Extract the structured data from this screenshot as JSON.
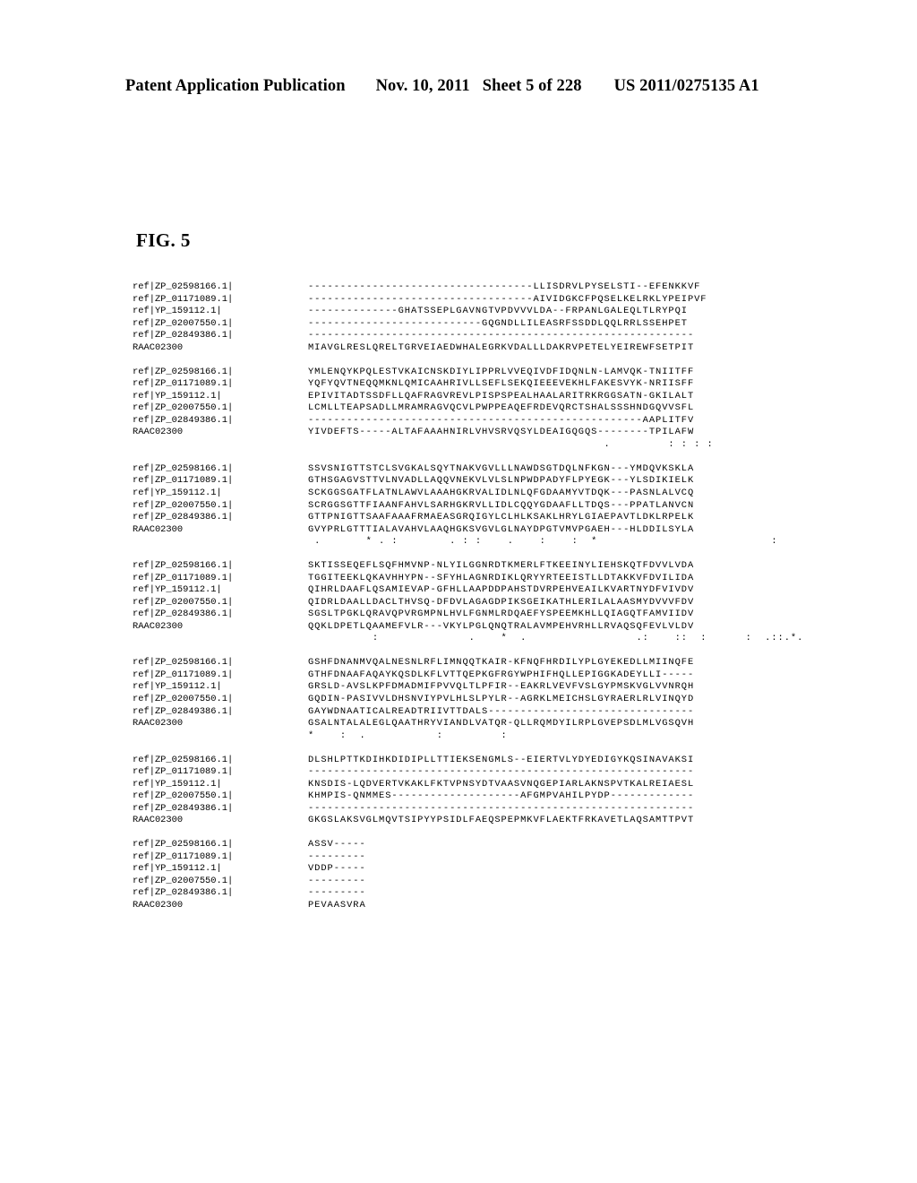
{
  "header": {
    "publication": "Patent Application Publication",
    "date": "Nov. 10, 2011",
    "sheet": "Sheet 5 of 228",
    "number": "US 2011/0275135 A1"
  },
  "figure": {
    "title": "FIG. 5"
  },
  "alignment": {
    "labels": [
      "ref|ZP_02598166.1|",
      "ref|ZP_01171089.1|",
      "ref|YP_159112.1|",
      "ref|ZP_02007550.1|",
      "ref|ZP_02849386.1|",
      "RAAC02300"
    ],
    "blocks": [
      {
        "sequences": [
          "-----------------------------------LLISDRVLPYSELSTI--EFENKKVF",
          "-----------------------------------AIVIDGKCFPQSELKELRKLYPEIPVF",
          "--------------GHATSSEPLGAVNGTVPDVVVLDA--FRPANLGALEQLTLRYPQI",
          "---------------------------GQGNDLLILEASRFSSDDLQQLRRLSSEHPET",
          "------------------------------------------------------------",
          "MIAVGLRESLQRELTGRVEIAEDWHALEGRKVDALLLDAKRVPETELYEIREWFSETPIT"
        ],
        "consensus": ""
      },
      {
        "sequences": [
          "YMLENQYKPQLESTVKAICNSKDIYLIPPRLVVEQIVDFIDQNLN-LAMVQK-TNIITFF",
          "YQFYQVTNEQQMKNLQMICAAHRIVLLSEFLSEKQIEEEVEKHLFAKESVYK-NRIISFF",
          "EPIVITADTSSDFLLQAFRAGVREVLPISPSPEALHAALARITRKRGGSATN-GKILALT",
          "LCMLLTEAPSADLLMRAMRAGVQCVLPWPPEAQEFRDEVQRCTSHALSSSHNDGQVVSFL",
          "----------------------------------------------------AAPLITFV",
          "YIVDEFTS-----ALTAFAAAHNIRLVHVSRVQSYLDEAIGQGQS--------TPILAFW"
        ],
        "consensus": "                                              .         : : : :"
      },
      {
        "sequences": [
          "SSVSNIGTTSTCLSVGKALSQYTNAKVGVLLLNAWDSGTDQLNFKGN---YMDQVKSKLA",
          "GTHSGAGVSTTVLNVADLLAQQVNEKVLVLSLNPWDPADYFLPYEGK---YLSDIKIELK",
          "SCKGGSGATFLATNLAWVLAAAHGKRVALIDLNLQFGDAAMYVTDQK---PASNLALVCQ",
          "SCRGGSGTTFIAANFAHVLSARHGKRVLLIDLCQQYGDAAFLLTDQS---PPATLANVCN",
          "GTTPNIGTTSAAFAAAFRMAEASGRQIGYLCLHLKSAKLHRYLGIAEPAVTLDKLRPELK",
          "GVYPRLGTTTIALAVAHVLAAQHGKSVGVLGLNAYDPGTVMVPGAEH---HLDDILSYLA"
        ],
        "consensus": " .       * . :        . : :    .    :    :  *                           :"
      },
      {
        "sequences": [
          "SKTISSEQEFLSQFHMVNP-NLYILGGNRDTKMERLFTKEEINYLIEHSKQTFDVVLVDA",
          "TGGITEEKLQKAVHHYPN--SFYHLAGNRDIKLQRYYRTEEISTLLDTAKKVFDVILIDA",
          "QIHRLDAAFLQSAMIEVAP-GFHLLAAPDDPAHSTDVRPEHVEAILKVARTNYDFVIVDV",
          "QIDRLDAALLDACLTHVSQ-DFDVLAGAGDPIKSGEIKATHLERILALAASMYDVVVFDV",
          "SGSLTPGKLQRAVQPVRGMPNLHVLFGNMLRDQAEFYSPEEMKHLLQIAGQTFAMVIIDV",
          "QQKLDPETLQAAMEFVLR---VKYLPGLQNQTRALAVMPEHVRHLLRVAQSQFEVLVLDV"
        ],
        "consensus": "          :              .    *  .                 .:    ::  :      :  .::.*."
      },
      {
        "sequences": [
          "GSHFDNANMVQALNESNLRFLIMNQQTKAIR-KFNQFHRDILYPLGYEKEDLLMIINQFE",
          "GTHFDNAAFAQAYKQSDLKFLVTTQEPKGFRGYWPHIFHQLLEPIGGKADEYLLI-----",
          "GRSLD-AVSLKPFDMADMIFPVVQLTLPFIR--EAKRLVEVFVSLGYPMSKVGLVVNRQH",
          "GQDIN-PASIVVLDHSNVIYPVLHLSLPYLR--AGRKLMEICHSLGYRAERLRLVINQYD",
          "GAYWDNAATICALREADTRIIVTTDALS--------------------------------",
          "GSALNTALALEGLQAATHRYVIANDLVATQR-QLLRQMDYILRPLGVEPSDLMLVGSQVH"
        ],
        "consensus": "*    :  .           :         :"
      },
      {
        "sequences": [
          "DLSHLPTTKDIHKDIDIPLLTTIEKSENGMLS--EIERTVLYDYEDIGYKQSINAVAKSI",
          "------------------------------------------------------------",
          "KNSDIS-LQDVERTVKAKLFKTVPNSYDTVAASVNQGEPIARLAKNSPVTKALREIAESL",
          "KHMPIS-QNMMES--------------------AFGMPVAHILPYDP-------------",
          "------------------------------------------------------------",
          "GKGSLAKSVGLMQVTSIPYYPSIDLFAEQSPEPMKVFLAEKTFRKAVETLAQSAMTTPVT"
        ],
        "consensus": ""
      },
      {
        "sequences": [
          "ASSV-----",
          "---------",
          "VDDP-----",
          "---------",
          "---------",
          "PEVAASVRA"
        ],
        "consensus": ""
      }
    ]
  }
}
